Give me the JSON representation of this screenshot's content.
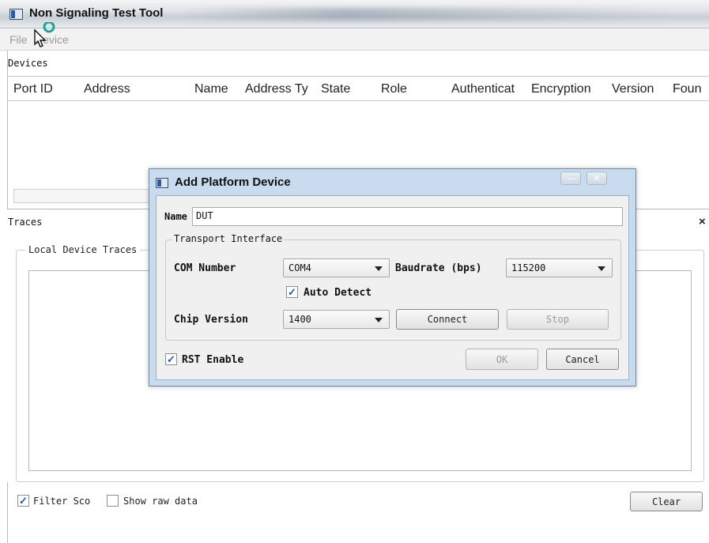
{
  "window": {
    "title": "Non Signaling Test Tool"
  },
  "menu": {
    "file": "File",
    "device": "Device"
  },
  "devices": {
    "label": "Devices",
    "columns": [
      "Port ID",
      "Address",
      "Name",
      "Address Ty",
      "State",
      "Role",
      "Authenticat",
      "Encryption",
      "Version",
      "Foun"
    ]
  },
  "traces": {
    "label": "Traces",
    "close": "×",
    "group_title": "Local Device Traces",
    "filter_sco": {
      "label": "Filter Sco",
      "checked": true
    },
    "show_raw": {
      "label": "Show raw data",
      "checked": false
    },
    "clear": "Clear"
  },
  "dialog": {
    "title": "Add Platform Device",
    "minimize": "—",
    "close": "✕",
    "name_label": "Name",
    "name_value": "DUT",
    "transport_title": "Transport Interface",
    "com_label": "COM Number",
    "com_value": "COM4",
    "baud_label": "Baudrate (bps)",
    "baud_value": "115200",
    "auto_detect": {
      "label": "Auto Detect",
      "checked": true
    },
    "chip_label": "Chip Version",
    "chip_value": "1400",
    "connect": "Connect",
    "stop": "Stop",
    "rst": {
      "label": "RST Enable",
      "checked": true
    },
    "ok": "OK",
    "cancel": "Cancel"
  }
}
